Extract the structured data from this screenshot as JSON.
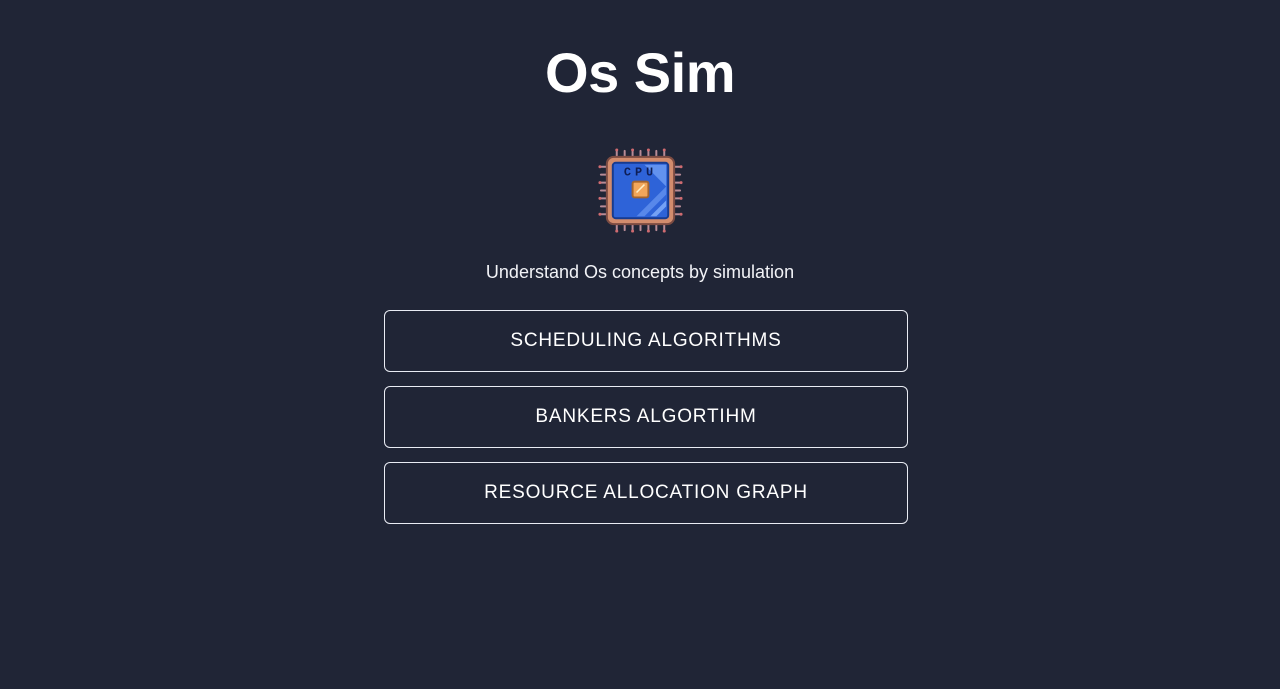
{
  "page": {
    "title": "Os Sim",
    "subtitle": "Understand Os concepts by simulation",
    "logo_icon": "cpu-chip-icon",
    "logo_text": "CPU"
  },
  "menu": {
    "items": [
      {
        "label": "SCHEDULING ALGORITHMS"
      },
      {
        "label": "BANKERS ALGORTIHM"
      },
      {
        "label": "RESOURCE ALLOCATION GRAPH"
      }
    ]
  },
  "colors": {
    "background": "#202536",
    "text": "#ffffff",
    "button_border": "#e9ecf4",
    "chip_blue": "#2e63d8",
    "chip_frame": "#d28c6d",
    "chip_core": "#f2a65a"
  }
}
